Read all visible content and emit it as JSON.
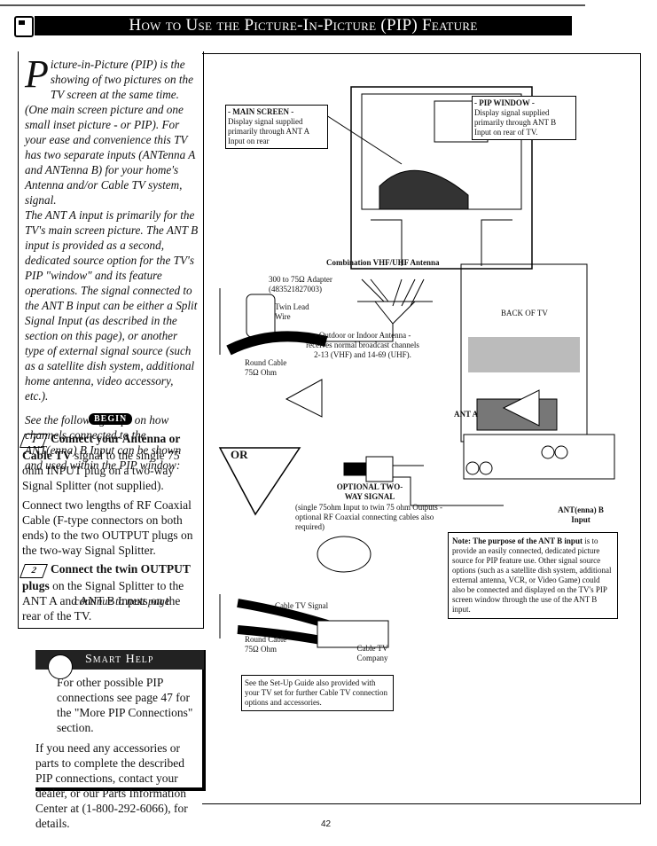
{
  "header": {
    "title": "How to Use the Picture-In-Picture (PIP) Feature",
    "icon": "tv-screen-icon"
  },
  "intro": {
    "dropcap": "P",
    "p1": "icture-in-Picture (PIP) is the showing of two pictures on the TV screen at the same time. (One main screen picture and one small inset picture - or PIP). For your ease and convenience this TV has two separate inputs (ANTenna A and ANTenna B) for your home's Antenna and/or Cable TV system, signal.",
    "p2": "The ANT A input is primarily for the TV's main screen picture. The ANT B input is provided as a second, dedicated source option for the TV's PIP \"window\" and its feature operations. The signal connected to the ANT B input can be either a Split Signal Input (as described in the section on this page), or another type of external signal source (such as a satellite dish system, additional home antenna, video accessory, etc.).",
    "p3": "See the following steps on how channels connected to the ANT(enna) B Input can be shown and used within the PIP window:"
  },
  "begin": "BEGIN",
  "steps": [
    {
      "num": "1",
      "bold": "Connect your Antenna or Cable TV",
      "text": " signal to the single 75 ohm INPUT plug on a two-way Signal Splitter (not supplied).",
      "text2": "Connect two lengths of RF Coaxial Cable (F-type connectors on both ends) to the two OUTPUT plugs on the two-way Signal Splitter."
    },
    {
      "num": "2",
      "bold": "Connect the twin OUTPUT plugs",
      "text": " on the Signal Splitter to the ANT A and ANT B Inputs on the rear of the TV."
    }
  ],
  "continue": "continue to next page",
  "smart_help": {
    "title": "Smart Help",
    "p1": "For other possible PIP connections see page 47 for the \"More PIP Connections\" section.",
    "p2": "If you need any accessories or parts to complete the described PIP connections, contact your dealer, or our Parts Information Center at (1-800-292-6066), for details.",
    "icon": "lightbulb-icon"
  },
  "diagram": {
    "main_screen": {
      "title": "- MAIN SCREEN -",
      "text": "Display signal supplied primarily through ANT A Input on rear"
    },
    "pip_window": {
      "title": "- PIP WINDOW -",
      "text": "Display signal supplied primarily through ANT B Input on rear of TV."
    },
    "antenna_title": "Combination VHF/UHF Antenna",
    "adapter": "300 to 75Ω Adapter (483521827003)",
    "twin_lead": "Twin Lead Wire",
    "or": "OR",
    "round_cable": "Round Cable 75Ω Ohm",
    "antenna_note": "- Outdoor or Indoor Antenna - receives normal broadcast channels 2-13 (VHF) and 14-69 (UHF).",
    "back_of_tv": "BACK OF TV",
    "ant_a": "ANT A",
    "ant_b": "ANT(enna) B Input",
    "splitter_title": "OPTIONAL TWO-WAY SIGNAL",
    "splitter_note": "(single 75ohm Input to twin 75 ohm Outputs - optional RF Coaxial connecting cables also required)",
    "note_bold": "Note: The purpose of the ANT B input",
    "note_text": " is to provide an easily connected, dedicated picture source for PIP feature use. Other signal source options (such as a satellite dish system, additional external antenna, VCR, or Video Game) could also be connected and displayed on the TV's PIP screen window through the use of the ANT B input.",
    "cable_signal": "Cable TV Signal",
    "round_cable2": "Round Cable 75Ω Ohm",
    "cable_company": "Cable TV Company",
    "setup_note": "See the Set-Up Guide also provided with your TV set for further Cable TV connection options and accessories."
  },
  "page_number": "42"
}
